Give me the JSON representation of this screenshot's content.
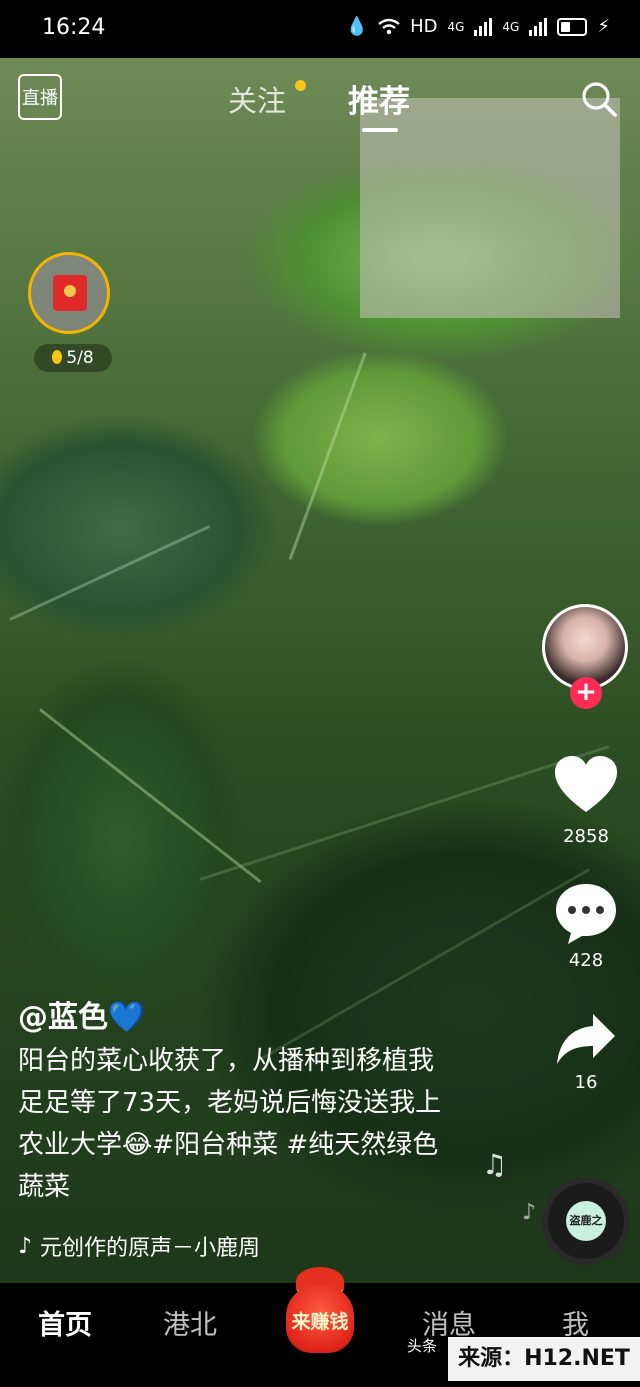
{
  "status_bar": {
    "time": "16:24",
    "indicators": [
      "HD",
      "4G",
      "4G"
    ],
    "icons": [
      "drop-icon",
      "wifi-icon",
      "signal-icon",
      "battery-icon"
    ]
  },
  "top_nav": {
    "live_label": "直播",
    "tabs": [
      {
        "label": "关注",
        "has_dot": true
      },
      {
        "label": "推荐",
        "active": true
      }
    ],
    "search_icon": "search-icon"
  },
  "reward_widget": {
    "icon": "red-packet-icon",
    "progress_text": "5/8"
  },
  "right_rail": {
    "likes": "2858",
    "comments": "428",
    "shares": "16",
    "follow_icon": "plus-icon"
  },
  "post": {
    "author": "@蓝色💙",
    "caption": "阳台的菜心收获了，从播种到移植我足足等了73天，老妈说后悔没送我上农业大学😂#阳台种菜 #纯天然绿色蔬菜",
    "music": "元创作的原声－小鹿周"
  },
  "disc_label": "盗鹿之",
  "bottom_nav": {
    "items": [
      "首页",
      "港北",
      "消息",
      "我"
    ],
    "earn_label": "来赚钱",
    "headline_tag": "头条"
  },
  "watermark": "来源：H12.NET",
  "colors": {
    "accent_red": "#fe2c55",
    "gold": "#f4b400"
  }
}
